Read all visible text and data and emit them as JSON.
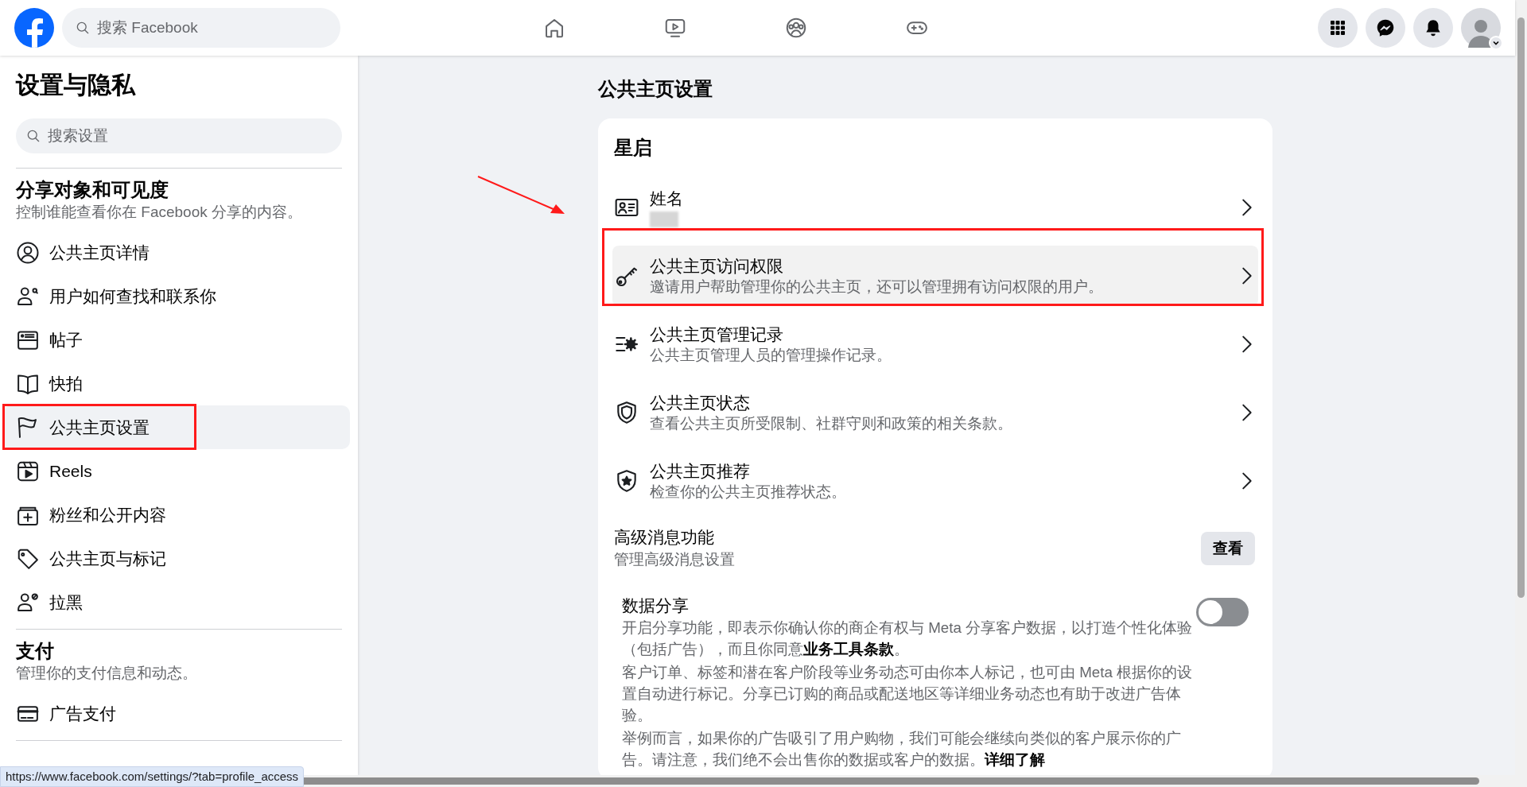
{
  "topbar": {
    "search": {
      "placeholder": "搜索 Facebook"
    }
  },
  "sidebar": {
    "title": "设置与隐私",
    "search": {
      "placeholder": "搜索设置"
    },
    "sections": [
      {
        "title": "分享对象和可见度",
        "description": "控制谁能查看你在 Facebook 分享的内容。",
        "items": [
          {
            "label": "公共主页详情",
            "selected": false
          },
          {
            "label": "用户如何查找和联系你",
            "selected": false
          },
          {
            "label": "帖子",
            "selected": false
          },
          {
            "label": "快拍",
            "selected": false
          },
          {
            "label": "公共主页设置",
            "selected": true
          },
          {
            "label": "Reels",
            "selected": false
          },
          {
            "label": "粉丝和公开内容",
            "selected": false
          },
          {
            "label": "公共主页与标记",
            "selected": false
          },
          {
            "label": "拉黑",
            "selected": false
          }
        ]
      },
      {
        "title": "支付",
        "description": "管理你的支付信息和动态。",
        "items": [
          {
            "label": "广告支付",
            "selected": false
          }
        ]
      }
    ]
  },
  "main": {
    "title": "公共主页设置",
    "card": {
      "heading": "星启",
      "rows": [
        {
          "title": "姓名",
          "selected": false
        },
        {
          "title": "公共主页访问权限",
          "subtitle": "邀请用户帮助管理你的公共主页，还可以管理拥有访问权限的用户。",
          "selected": true
        },
        {
          "title": "公共主页管理记录",
          "subtitle": "公共主页管理人员的管理操作记录。",
          "selected": false
        },
        {
          "title": "公共主页状态",
          "subtitle": "查看公共主页所受限制、社群守则和政策的相关条款。",
          "selected": false
        },
        {
          "title": "公共主页推荐",
          "subtitle": "检查你的公共主页推荐状态。",
          "selected": false
        }
      ],
      "messaging": {
        "title": "高级消息功能",
        "description": "管理高级消息设置",
        "button": "查看"
      },
      "data_sharing": {
        "title": "数据分享",
        "on": false,
        "paragraphs": [
          {
            "text": "开启分享功能，即表示你确认你的商企有权与 Meta 分享客户数据，以打造个性化体验（包括广告），而且你同意",
            "link": "业务工具条款",
            "after": "。"
          },
          {
            "text": "客户订单、标签和潜在客户阶段等业务动态可由你本人标记，也可由 Meta 根据你的设置自动进行标记。分享已订购的商品或配送地区等详细业务动态也有助于改进广告体验。"
          },
          {
            "text": "举例而言，如果你的广告吸引了用户购物，我们可能会继续向类似的客户展示你的广告。请注意，我们绝不会出售你的数据或客户的数据。",
            "link": "详细了解"
          }
        ]
      }
    }
  },
  "status_url": "https://www.facebook.com/settings/?tab=profile_access"
}
